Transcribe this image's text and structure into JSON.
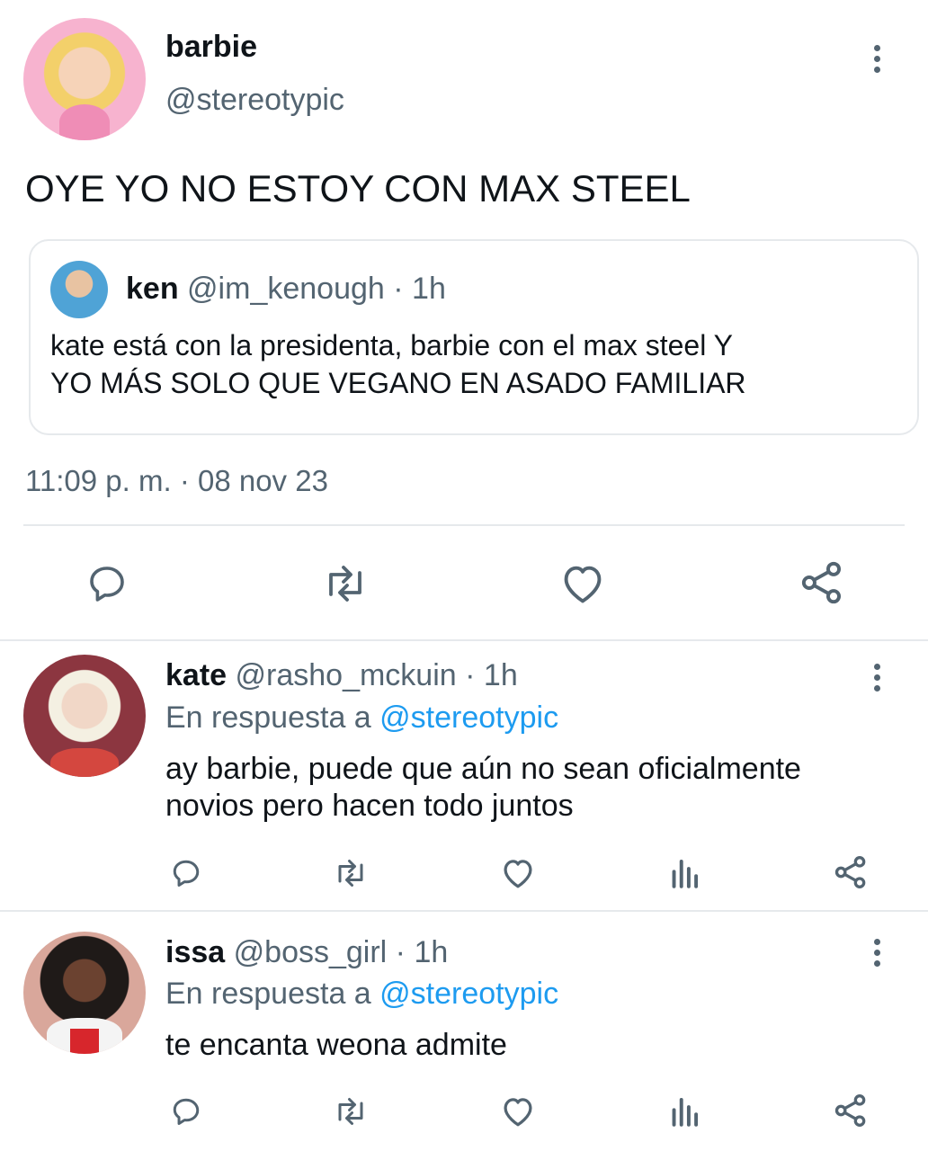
{
  "main_tweet": {
    "author_name": "barbie",
    "author_handle": "@stereotypic",
    "text": "OYE YO NO ESTOY CON MAX STEEL",
    "quoted": {
      "author_name": "ken",
      "author_handle": "@im_kenough",
      "time_sep": " · ",
      "time": "1h",
      "text_line1": "kate está con la presidenta, barbie con el max steel Y",
      "text_line2": "YO MÁS SOLO QUE VEGANO EN ASADO FAMILIAR"
    },
    "timestamp": "11:09 p. m. · 08 nov 23",
    "actions": [
      "reply-icon",
      "retweet-icon",
      "like-icon",
      "share-icon"
    ]
  },
  "replies": [
    {
      "author_name": "kate",
      "author_handle": "@rasho_mckuin",
      "time_sep": " · ",
      "time": "1h",
      "reply_prefix": "En respuesta a ",
      "reply_to": "@stereotypic",
      "text_line1": "ay barbie, puede que aún no sean oficialmente",
      "text_line2": "novios pero hacen todo juntos"
    },
    {
      "author_name": "issa",
      "author_handle": "@boss_girl",
      "time_sep": " · ",
      "time": "1h",
      "reply_prefix": "En respuesta a ",
      "reply_to": "@stereotypic",
      "text_line1": "te encanta weona admite"
    }
  ],
  "colors": {
    "accent": "#1d9bf0",
    "muted": "#536471",
    "text": "#0f1419",
    "border": "#e6e9ec"
  }
}
